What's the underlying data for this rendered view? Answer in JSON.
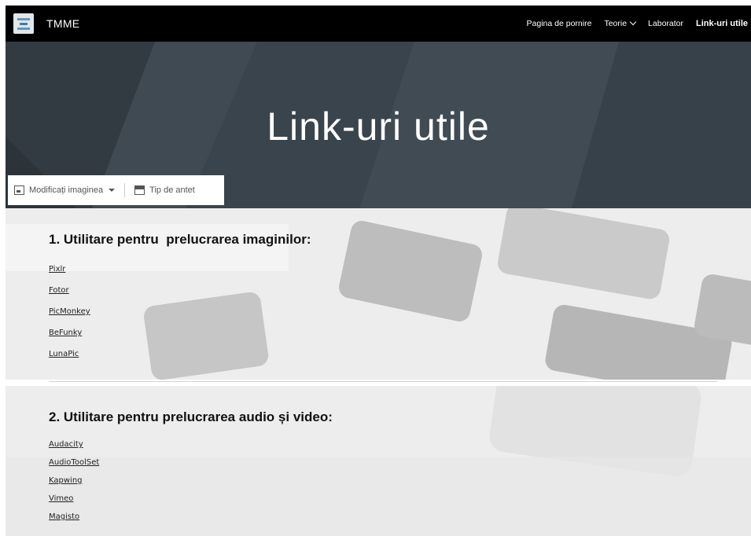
{
  "site": {
    "name": "TMME"
  },
  "nav": {
    "items": [
      {
        "label": "Pagina de pornire"
      },
      {
        "label": "Teorie"
      },
      {
        "label": "Laborator"
      },
      {
        "label": "Link-uri utile"
      }
    ]
  },
  "hero": {
    "title": "Link-uri utile",
    "change_image_label": "Modificați imaginea",
    "header_type_label": "Tip de antet"
  },
  "sections": [
    {
      "title": "1. Utilitare pentru  prelucrarea imaginilor:",
      "links": [
        "Pixlr",
        "Fotor",
        "PicMonkey",
        "BeFunky",
        "LunaPic"
      ]
    },
    {
      "title": "2. Utilitare pentru prelucrarea audio și video:",
      "links": [
        "Audacity",
        "AudioToolSet",
        "Kapwing",
        "Vimeo",
        "Magisto"
      ]
    }
  ]
}
